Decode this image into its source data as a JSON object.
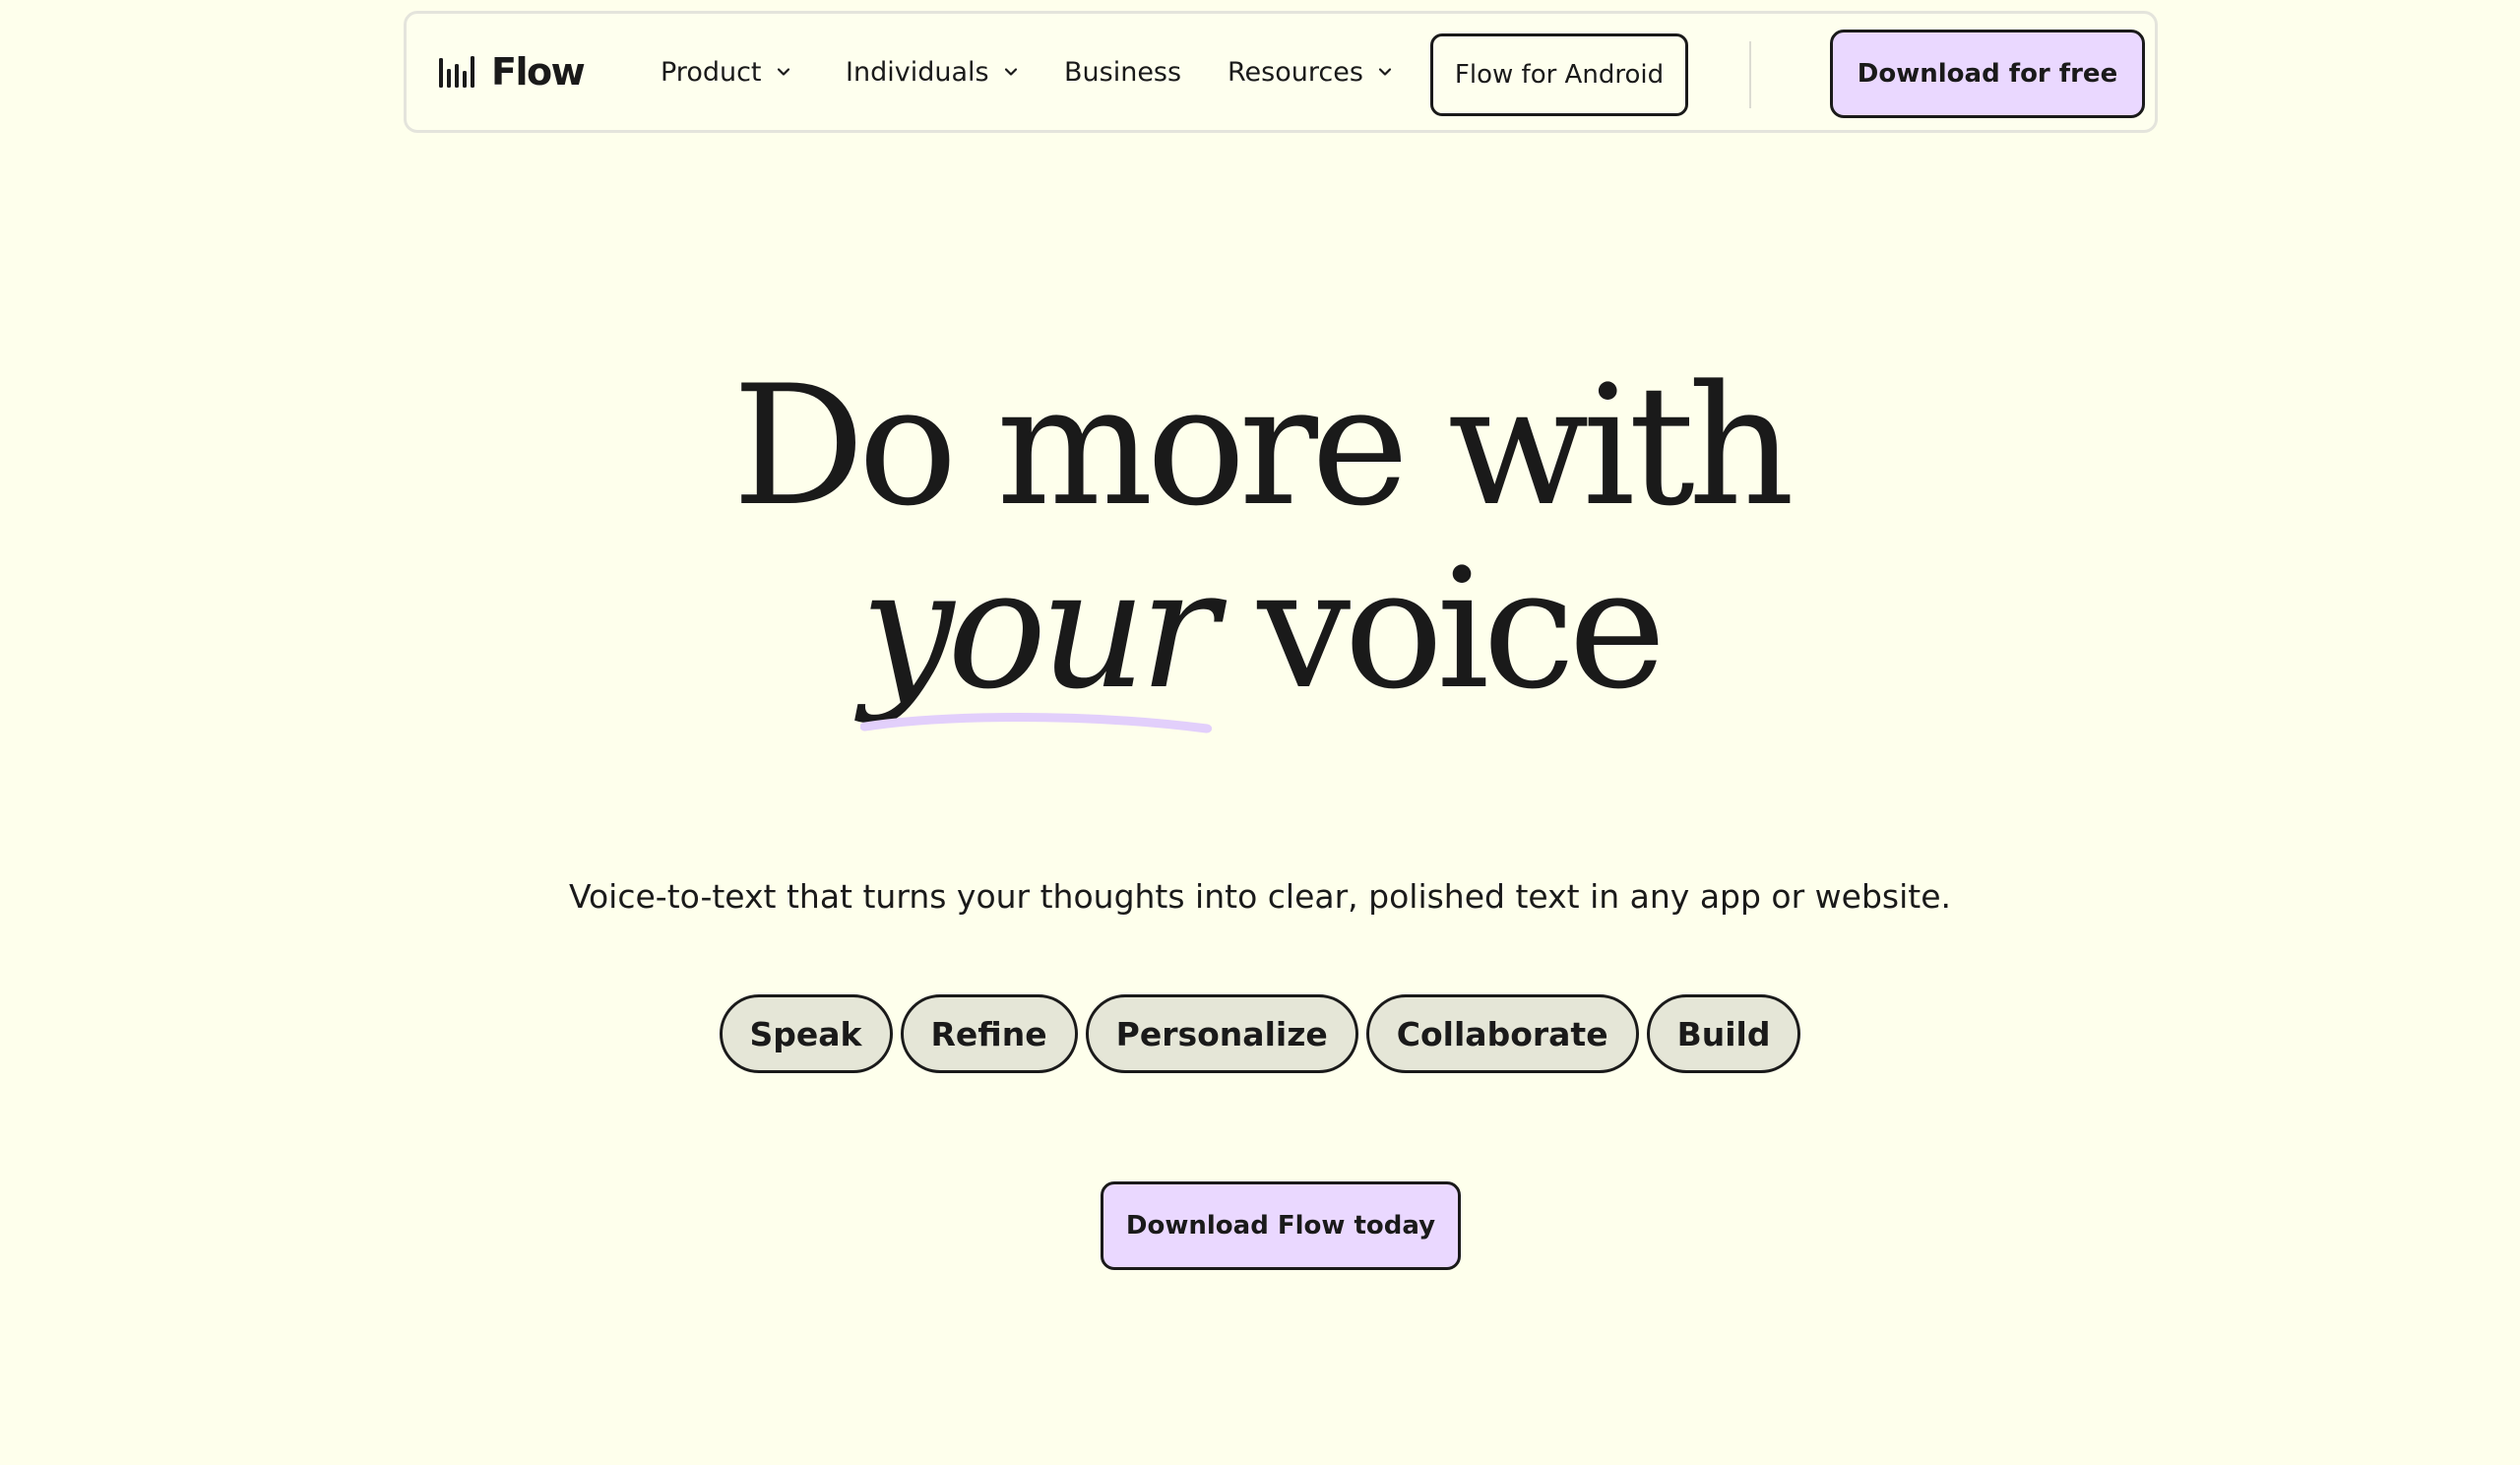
{
  "brand": {
    "name": "Flow",
    "logo_icon": "waveform-bars-icon"
  },
  "nav": {
    "items": [
      {
        "label": "Product",
        "has_dropdown": true
      },
      {
        "label": "Individuals",
        "has_dropdown": true
      },
      {
        "label": "Business",
        "has_dropdown": false
      },
      {
        "label": "Resources",
        "has_dropdown": true
      }
    ],
    "android_button": "Flow for Android",
    "download_button": "Download for free"
  },
  "hero": {
    "title_line1": "Do more with",
    "title_accent": "your",
    "title_line2_rest": "voice",
    "subtitle": "Voice-to-text that turns your thoughts into clear, polished text in any app or website.",
    "pills": [
      "Speak",
      "Refine",
      "Personalize",
      "Collaborate",
      "Build"
    ],
    "cta": "Download Flow today"
  },
  "colors": {
    "background": "#FEFFEC",
    "accent_purple": "#EAD8FF",
    "pill_fill": "#E5E6D7",
    "underline": "#E2CFFB",
    "text": "#1a1a1a"
  }
}
